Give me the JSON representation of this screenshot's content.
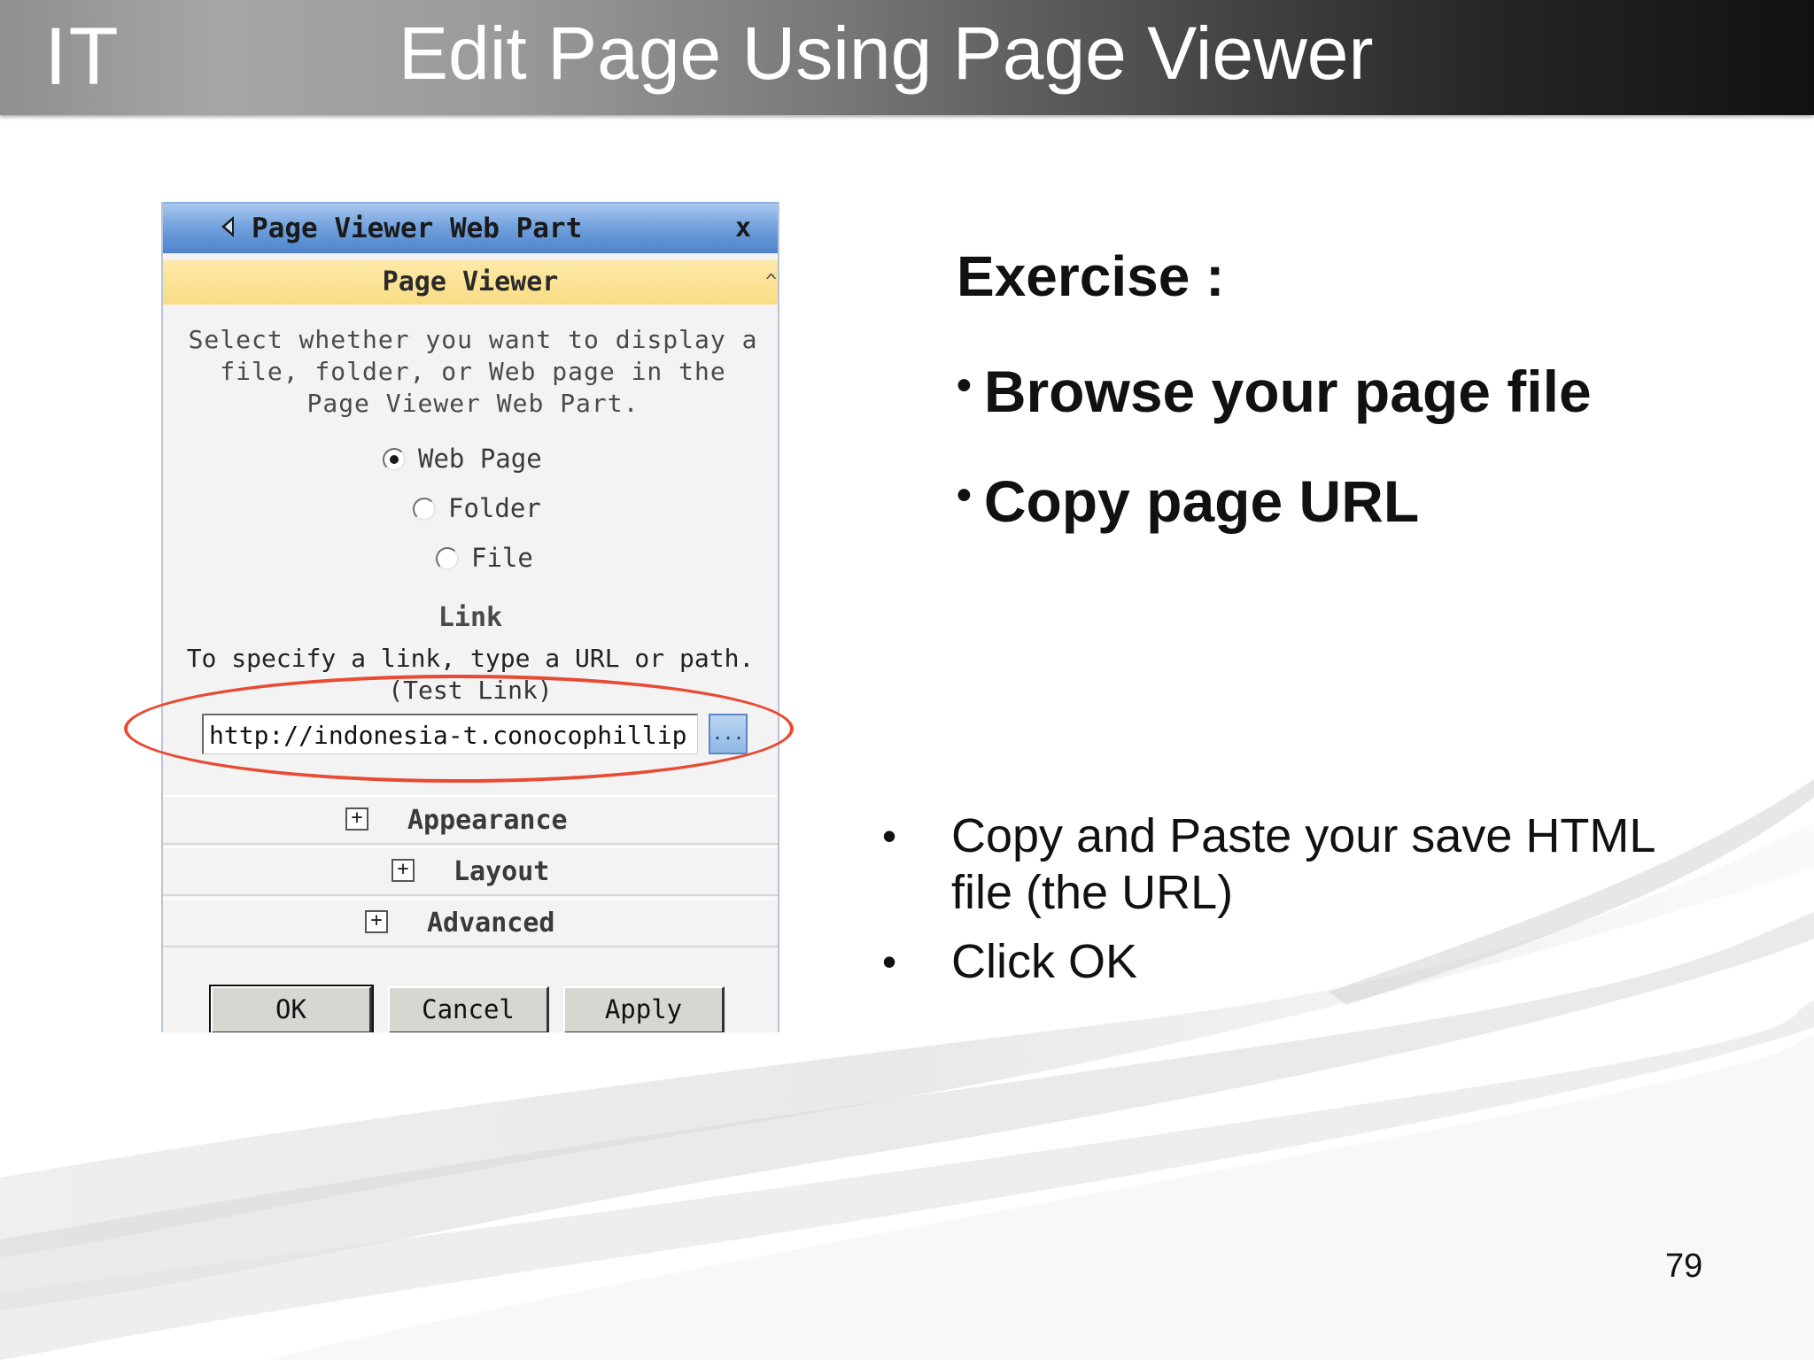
{
  "slide": {
    "brand_label": "IT",
    "title": "Edit Page Using Page Viewer",
    "page_number": "79"
  },
  "webpart": {
    "title": "Page Viewer Web Part",
    "close_glyph": "x",
    "section_title": "Page Viewer",
    "section_toggle_glyph": "^",
    "description": "Select whether you want to display a file, folder, or Web page in the Page Viewer Web Part.",
    "options": [
      {
        "label": "Web Page",
        "selected": true
      },
      {
        "label": "Folder",
        "selected": false
      },
      {
        "label": "File",
        "selected": false
      }
    ],
    "link_heading": "Link",
    "link_help": "To specify a link, type a URL or path.",
    "test_link_label": "(Test Link)",
    "url_value": "http://indonesia-t.conocophillip",
    "browse_label": "...",
    "collapsible_sections": [
      {
        "label": "Appearance",
        "expander": "+"
      },
      {
        "label": "Layout",
        "expander": "+"
      },
      {
        "label": "Advanced",
        "expander": "+"
      }
    ],
    "buttons": {
      "ok": "OK",
      "cancel": "Cancel",
      "apply": "Apply"
    }
  },
  "exercise": {
    "heading": "Exercise :",
    "items": [
      "Browse your page file",
      "Copy page URL"
    ]
  },
  "steps": [
    "Copy and Paste your save HTML file (the URL)",
    "Click OK"
  ],
  "bullet_glyph": "•",
  "colors": {
    "titlebar_blue": "#4e84cc",
    "section_yellow": "#f9dc85",
    "highlight_red": "#e84a33"
  }
}
